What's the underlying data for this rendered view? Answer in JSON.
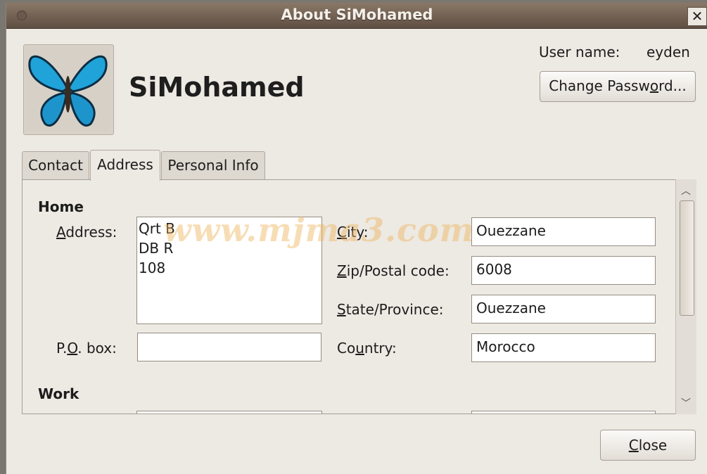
{
  "window": {
    "title": "About SiMohamed",
    "close_glyph": "✕"
  },
  "profile": {
    "display_name": "SiMohamed",
    "user_name_label": "User name:",
    "user_name_value": "eyden",
    "avatar_icon": "butterfly-image"
  },
  "buttons": {
    "change_password_pre": "Change Passw",
    "change_password_mn": "o",
    "change_password_post": "rd...",
    "close_mn": "C",
    "close_post": "lose"
  },
  "tabs": [
    {
      "label": "Contact"
    },
    {
      "label": "Address"
    },
    {
      "label": "Personal Info"
    }
  ],
  "home": {
    "section_label": "Home",
    "address_label_mn": "A",
    "address_label_rest": "ddress:",
    "address_lines": [
      "Qrt B",
      "DB R",
      "108"
    ],
    "pobox_label_pre": "P.",
    "pobox_label_mn": "O",
    "pobox_label_post": ". box:",
    "pobox_value": "",
    "city_label_mn": "C",
    "city_label_rest": "ity:",
    "city_value": "Ouezzane",
    "zip_label_mn": "Z",
    "zip_label_rest": "ip/Postal code:",
    "zip_value": "6008",
    "state_label_mn": "S",
    "state_label_rest": "tate/Province:",
    "state_value": "Ouezzane",
    "country_label_pre": "Co",
    "country_label_mn": "u",
    "country_label_rest": "ntry:",
    "country_value": "Morocco"
  },
  "work": {
    "section_label": "Work"
  },
  "watermark": "www.mjma3.com"
}
